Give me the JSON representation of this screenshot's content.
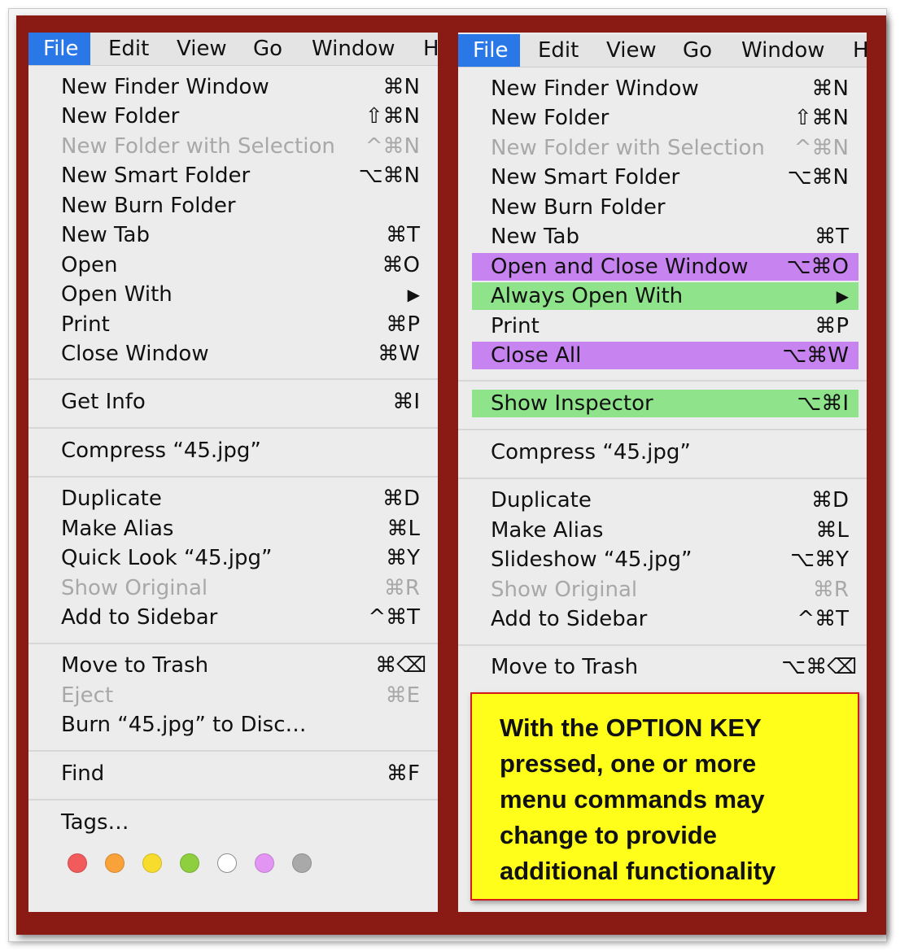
{
  "menubar": {
    "items": [
      "File",
      "Edit",
      "View",
      "Go",
      "Window",
      "H"
    ]
  },
  "left_menu": {
    "items": [
      {
        "label": "New Finder Window",
        "shortcut": "⌘N"
      },
      {
        "label": "New Folder",
        "shortcut": "⇧⌘N"
      },
      {
        "label": "New Folder with Selection",
        "shortcut": "^⌘N"
      },
      {
        "label": "New Smart Folder",
        "shortcut": "⌥⌘N"
      },
      {
        "label": "New Burn Folder",
        "shortcut": ""
      },
      {
        "label": "New Tab",
        "shortcut": "⌘T"
      },
      {
        "label": "Open",
        "shortcut": "⌘O"
      },
      {
        "label": "Open With",
        "shortcut": "▶"
      },
      {
        "label": "Print",
        "shortcut": "⌘P"
      },
      {
        "label": "Close Window",
        "shortcut": "⌘W"
      },
      {
        "label": "Get Info",
        "shortcut": "⌘I"
      },
      {
        "label": "Compress “45.jpg”",
        "shortcut": ""
      },
      {
        "label": "Duplicate",
        "shortcut": "⌘D"
      },
      {
        "label": "Make Alias",
        "shortcut": "⌘L"
      },
      {
        "label": "Quick Look “45.jpg”",
        "shortcut": "⌘Y"
      },
      {
        "label": "Show Original",
        "shortcut": "⌘R"
      },
      {
        "label": "Add to Sidebar",
        "shortcut": "^⌘T"
      },
      {
        "label": "Move to Trash",
        "shortcut": "⌘⌫"
      },
      {
        "label": "Eject",
        "shortcut": "⌘E"
      },
      {
        "label": "Burn “45.jpg” to Disc…",
        "shortcut": ""
      },
      {
        "label": "Find",
        "shortcut": "⌘F"
      },
      {
        "label": "Tags…",
        "shortcut": ""
      }
    ]
  },
  "right_menu": {
    "items": [
      {
        "label": "New Finder Window",
        "shortcut": "⌘N"
      },
      {
        "label": "New Folder",
        "shortcut": "⇧⌘N"
      },
      {
        "label": "New Folder with Selection",
        "shortcut": "^⌘N"
      },
      {
        "label": "New Smart Folder",
        "shortcut": "⌥⌘N"
      },
      {
        "label": "New Burn Folder",
        "shortcut": ""
      },
      {
        "label": "New Tab",
        "shortcut": "⌘T"
      },
      {
        "label": "Open and Close Window",
        "shortcut": "⌥⌘O"
      },
      {
        "label": "Always Open With",
        "shortcut": "▶"
      },
      {
        "label": "Print",
        "shortcut": "⌘P"
      },
      {
        "label": "Close All",
        "shortcut": "⌥⌘W"
      },
      {
        "label": "Show Inspector",
        "shortcut": "⌥⌘I"
      },
      {
        "label": "Compress “45.jpg”",
        "shortcut": ""
      },
      {
        "label": "Duplicate",
        "shortcut": "⌘D"
      },
      {
        "label": "Make Alias",
        "shortcut": "⌘L"
      },
      {
        "label": "Slideshow “45.jpg”",
        "shortcut": "⌥⌘Y"
      },
      {
        "label": "Show Original",
        "shortcut": "⌘R"
      },
      {
        "label": "Add to Sidebar",
        "shortcut": "^⌘T"
      },
      {
        "label": "Move to Trash",
        "shortcut": "⌥⌘⌫"
      }
    ]
  },
  "tag_colors": [
    "#f25b5b",
    "#f9a23a",
    "#f7dc2d",
    "#8dcf3e",
    "#ffffff",
    "#e395f3",
    "#a9a9a9"
  ],
  "highlight_colors": {
    "changed": "#c783ef",
    "new": "#8ee38b"
  },
  "note": {
    "lines": [
      "With the OPTION KEY",
      "pressed, one or more",
      "menu commands may",
      "change to provide",
      "additional functionality"
    ]
  }
}
